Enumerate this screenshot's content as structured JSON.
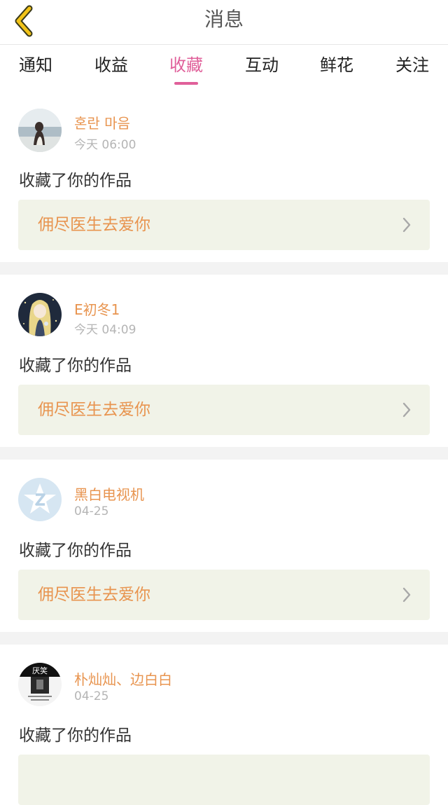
{
  "header": {
    "title": "消息",
    "back_icon": "chevron-left-icon",
    "back_color": "#f2c318"
  },
  "tabs": [
    {
      "label": "通知",
      "active": false
    },
    {
      "label": "收益",
      "active": false
    },
    {
      "label": "收藏",
      "active": true
    },
    {
      "label": "互动",
      "active": false
    },
    {
      "label": "鲜花",
      "active": false
    },
    {
      "label": "关注",
      "active": false
    }
  ],
  "colors": {
    "accent": "#e0609a",
    "username": "#e8944f",
    "work_box_bg": "#f1f3e8",
    "separator": "#f3f3f3"
  },
  "messages": [
    {
      "username": "혼란 마음",
      "time": "今天 06:00",
      "action": "收藏了你的作品",
      "work_title": "佣尽医生去爱你",
      "avatar": "girl-by-sea-avatar"
    },
    {
      "username": "E初冬1",
      "time": "今天 04:09",
      "action": "收藏了你的作品",
      "work_title": "佣尽医生去爱你",
      "avatar": "anime-girl-avatar"
    },
    {
      "username": "黑白电视机",
      "time": "04-25",
      "action": "收藏了你的作品",
      "work_title": "佣尽医生去爱你",
      "avatar": "qq-default-avatar"
    },
    {
      "username": "朴灿灿、边白白",
      "time": "04-25",
      "action": "收藏了你的作品",
      "work_title": "",
      "avatar": "black-white-photo-avatar",
      "avatar_caption": "厌笑"
    }
  ]
}
